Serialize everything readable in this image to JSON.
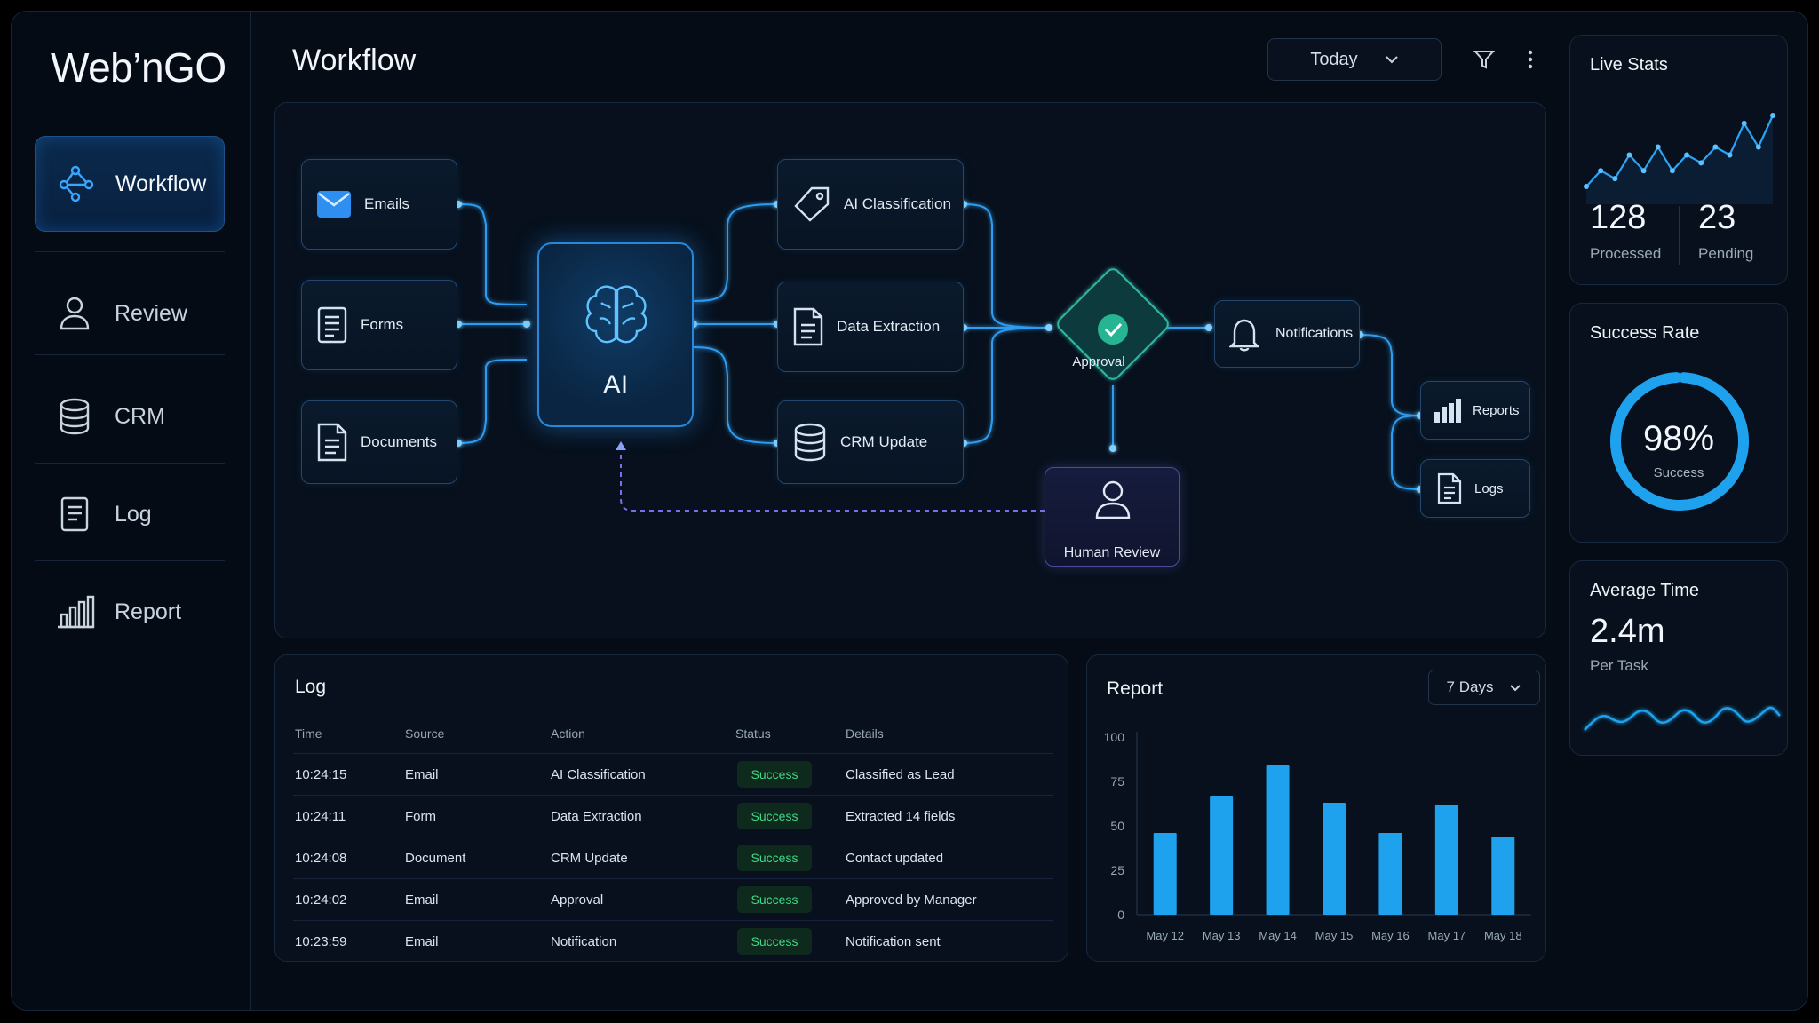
{
  "app": {
    "logo": "Web’nGO",
    "title": "Workflow"
  },
  "sidebar": {
    "items": [
      {
        "label": "Workflow",
        "icon": "workflow-icon",
        "active": true
      },
      {
        "label": "Review",
        "icon": "user-icon"
      },
      {
        "label": "CRM",
        "icon": "database-icon"
      },
      {
        "label": "Log",
        "icon": "document-icon"
      },
      {
        "label": "Report",
        "icon": "bar-chart-icon"
      }
    ]
  },
  "header": {
    "date_filter": "Today",
    "filter_icon": "filter-icon",
    "menu_icon": "more-vertical-icon"
  },
  "workflow": {
    "inputs": [
      {
        "label": "Emails",
        "icon": "mail-icon"
      },
      {
        "label": "Forms",
        "icon": "form-icon"
      },
      {
        "label": "Documents",
        "icon": "document-icon"
      }
    ],
    "ai_label": "AI",
    "steps": [
      {
        "label": "AI Classification",
        "icon": "tag-icon"
      },
      {
        "label": "Data Extraction",
        "icon": "document-icon"
      },
      {
        "label": "CRM Update",
        "icon": "database-icon"
      }
    ],
    "approval_label": "Approval",
    "human_review_label": "Human Review",
    "notifications_label": "Notifications",
    "outputs": [
      {
        "label": "Reports",
        "icon": "bar-chart-icon"
      },
      {
        "label": "Logs",
        "icon": "document-icon"
      }
    ]
  },
  "log": {
    "title": "Log",
    "columns": [
      "Time",
      "Source",
      "Action",
      "Status",
      "Details"
    ],
    "rows": [
      {
        "time": "10:24:15",
        "source": "Email",
        "action": "AI Classification",
        "status": "Success",
        "details": "Classified as Lead"
      },
      {
        "time": "10:24:11",
        "source": "Form",
        "action": "Data Extraction",
        "status": "Success",
        "details": "Extracted 14 fields"
      },
      {
        "time": "10:24:08",
        "source": "Document",
        "action": "CRM Update",
        "status": "Success",
        "details": "Contact updated"
      },
      {
        "time": "10:24:02",
        "source": "Email",
        "action": "Approval",
        "status": "Success",
        "details": "Approved by Manager"
      },
      {
        "time": "10:23:59",
        "source": "Email",
        "action": "Notification",
        "status": "Success",
        "details": "Notification sent"
      }
    ]
  },
  "report": {
    "title": "Report",
    "range_filter": "7 Days"
  },
  "chart_data": {
    "type": "bar",
    "title": "Report",
    "categories": [
      "May 12",
      "May 13",
      "May 14",
      "May 15",
      "May 16",
      "May 17",
      "May 18"
    ],
    "values": [
      46,
      67,
      84,
      63,
      46,
      62,
      44
    ],
    "yticks": [
      0,
      25,
      50,
      75,
      100
    ],
    "ylim": [
      0,
      100
    ],
    "grid": false,
    "color": "#1fa2ee"
  },
  "live_stats": {
    "title": "Live Stats",
    "processed": "128",
    "processed_label": "Processed",
    "pending": "23",
    "pending_label": "Pending",
    "sparkline": [
      1,
      3,
      2,
      5,
      3,
      6,
      3,
      5,
      4,
      6,
      5,
      9,
      6,
      10
    ]
  },
  "success_rate": {
    "title": "Success Rate",
    "value": "98%",
    "label": "Success",
    "fraction": 0.98,
    "color": "#1fa2ee"
  },
  "average_time": {
    "title": "Average Time",
    "value": "2.4m",
    "label": "Per Task"
  },
  "colors": {
    "accent": "#1fa2ee",
    "success": "#3fd887",
    "background": "#060c16"
  }
}
